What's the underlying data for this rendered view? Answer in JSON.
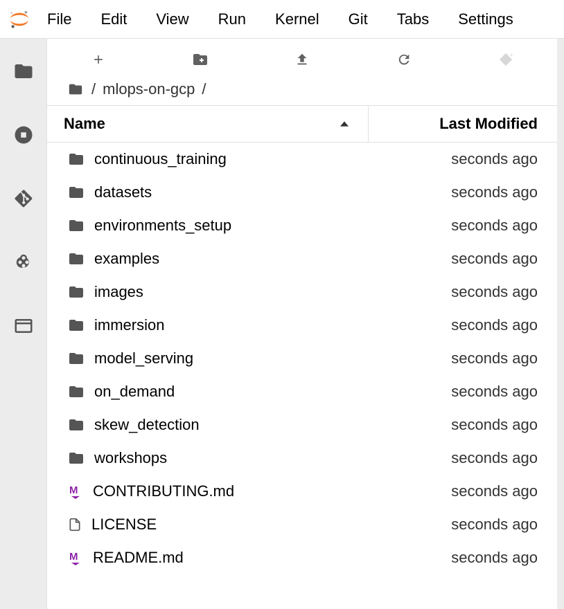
{
  "menubar": {
    "items": [
      "File",
      "Edit",
      "View",
      "Run",
      "Kernel",
      "Git",
      "Tabs",
      "Settings"
    ]
  },
  "breadcrumb": {
    "sep": "/",
    "segments": [
      "mlops-on-gcp"
    ],
    "trailing": "/"
  },
  "columns": {
    "name": "Name",
    "modified": "Last Modified"
  },
  "files": [
    {
      "name": "continuous_training",
      "type": "folder",
      "modified": "seconds ago"
    },
    {
      "name": "datasets",
      "type": "folder",
      "modified": "seconds ago"
    },
    {
      "name": "environments_setup",
      "type": "folder",
      "modified": "seconds ago"
    },
    {
      "name": "examples",
      "type": "folder",
      "modified": "seconds ago"
    },
    {
      "name": "images",
      "type": "folder",
      "modified": "seconds ago"
    },
    {
      "name": "immersion",
      "type": "folder",
      "modified": "seconds ago"
    },
    {
      "name": "model_serving",
      "type": "folder",
      "modified": "seconds ago"
    },
    {
      "name": "on_demand",
      "type": "folder",
      "modified": "seconds ago"
    },
    {
      "name": "skew_detection",
      "type": "folder",
      "modified": "seconds ago"
    },
    {
      "name": "workshops",
      "type": "folder",
      "modified": "seconds ago"
    },
    {
      "name": "CONTRIBUTING.md",
      "type": "markdown",
      "modified": "seconds ago"
    },
    {
      "name": "LICENSE",
      "type": "file",
      "modified": "seconds ago"
    },
    {
      "name": "README.md",
      "type": "markdown",
      "modified": "seconds ago"
    }
  ]
}
